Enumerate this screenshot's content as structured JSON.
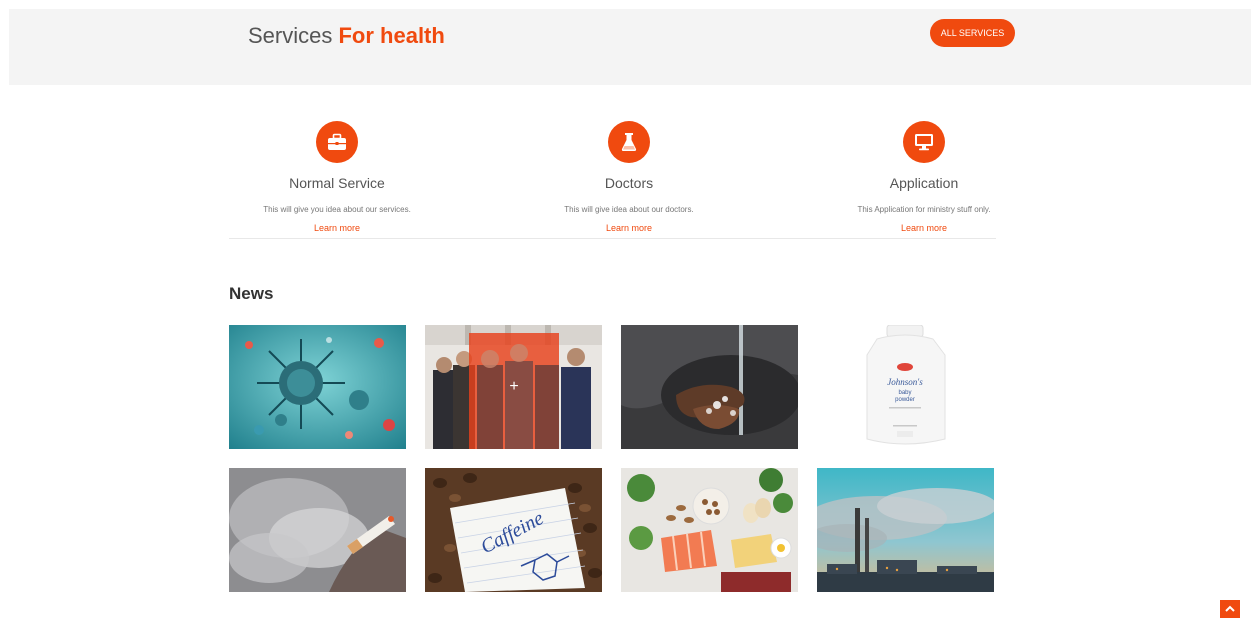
{
  "services_header": {
    "title_prefix": "Services ",
    "title_accent": "For health",
    "all_button": "ALL SERVICES"
  },
  "services": [
    {
      "title": "Normal Service",
      "description": "This will give you idea about our services.",
      "link": "Learn more",
      "icon": "briefcase-icon"
    },
    {
      "title": "Doctors",
      "description": "This will give idea about our doctors.",
      "link": "Learn more",
      "icon": "flask-icon"
    },
    {
      "title": "Application",
      "description": "This Application for ministry stuff only.",
      "link": "Learn more",
      "icon": "monitor-icon"
    }
  ],
  "news": {
    "heading": "News",
    "items": [
      {
        "image": "virus-image"
      },
      {
        "image": "group-photo-image",
        "overlay_text": "+"
      },
      {
        "image": "handwashing-image"
      },
      {
        "image": "baby-powder-image",
        "label_line1": "Johnson's",
        "label_line2": "baby",
        "label_line3": "powder"
      },
      {
        "image": "cigarette-image"
      },
      {
        "image": "caffeine-image",
        "handwritten": "Caffeine"
      },
      {
        "image": "healthy-food-image"
      },
      {
        "image": "factory-smoke-image"
      }
    ]
  },
  "colors": {
    "accent": "#f04a0f",
    "hero_bg": "#f4f4f4"
  }
}
